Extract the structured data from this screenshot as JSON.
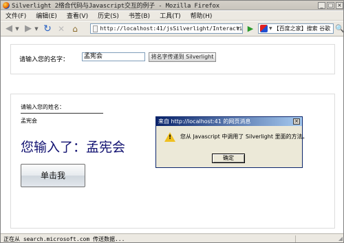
{
  "window": {
    "title": "Silverlight 2络合代码与Javascript交互的例子 - Mozilla Firefox",
    "min_label": "_",
    "max_label": "□",
    "close_label": "×"
  },
  "menu": [
    "文件(F)",
    "编辑(E)",
    "查看(V)",
    "历史(S)",
    "书签(B)",
    "工具(T)",
    "帮助(H)"
  ],
  "navbar": {
    "back_icon": "◀",
    "back_dropdown": "▼",
    "forward_icon": "▶",
    "forward_dropdown": "▼",
    "reload_icon": "↻",
    "stop_icon": "✕",
    "home_icon": "⌂",
    "url": "http://localhost:41/jsSilverlight/InteractiveSample.aspx",
    "url_dropdown": "▼",
    "go_icon": "▶",
    "search_placeholder": "【百度之家】搜索 谷歌",
    "search_dropdown": "▼",
    "search_go_icon": "🔍"
  },
  "panel1": {
    "label": "请输入您的名字：",
    "input_value": "孟宪会",
    "button_label": "将名字传递到 Silverlight"
  },
  "panel2": {
    "label": "请输入您的姓名：",
    "name_value": "孟宪会",
    "big_text": "您输入了：孟宪会",
    "button_label": "单击我"
  },
  "dialog": {
    "title": "来自 http://localhost:41 的网页消息",
    "close_label": "×",
    "warning_mark": "!",
    "message": "您从 Javascript 中调用了 Silverlight 里面的方法。",
    "ok_label": "确定"
  },
  "status": {
    "text": "正在从 search.microsoft.com 传送数据..."
  },
  "colors": {
    "big_text": "#101070",
    "dialog_title": "#0a246a"
  }
}
